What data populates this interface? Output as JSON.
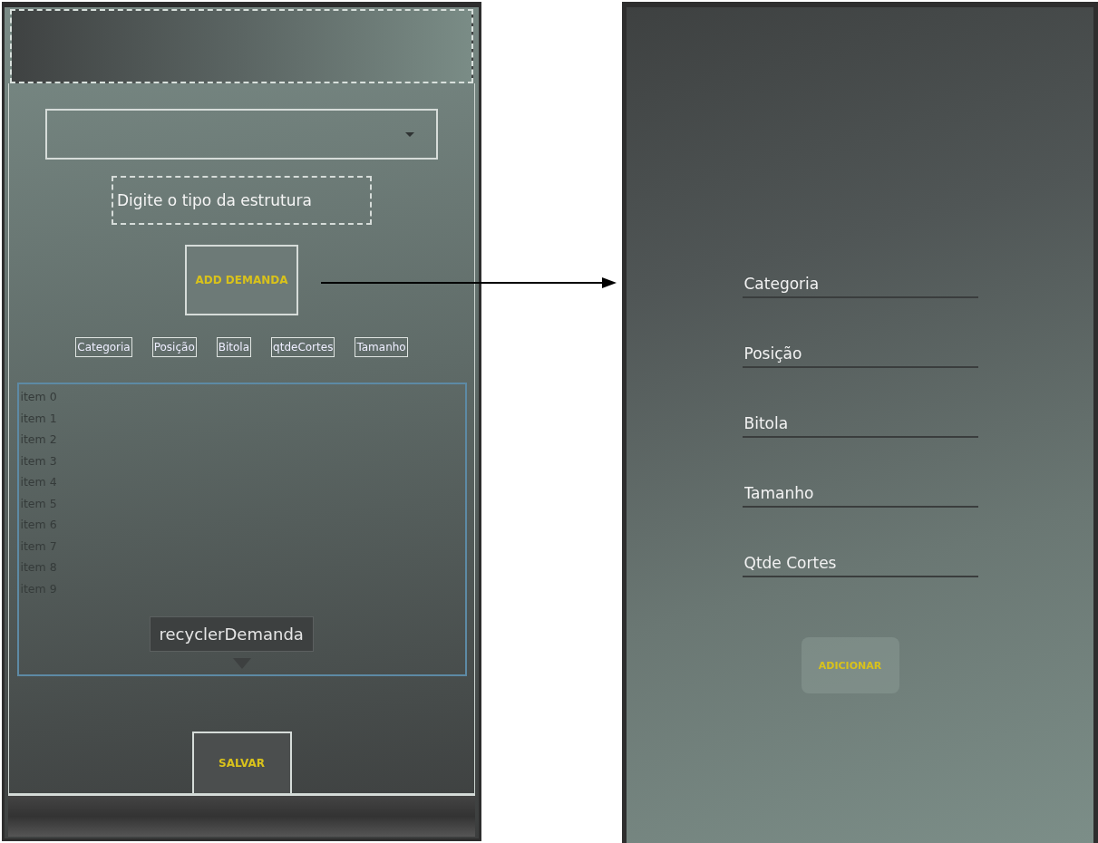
{
  "design_screen": {
    "structure_field": {
      "placeholder": "Digite o tipo da estrutura"
    },
    "add_button": "ADD DEMANDA",
    "headers": [
      "Categoria",
      "Posição",
      "Bitola",
      "qtdeCortes",
      "Tamanho"
    ],
    "list_items": [
      "item 0",
      "item 1",
      "item 2",
      "item 3",
      "item 4",
      "item 5",
      "item 6",
      "item 7",
      "item 8",
      "item 9"
    ],
    "tooltip": "recyclerDemanda",
    "save_button": "SALVAR"
  },
  "dialog_screen": {
    "fields": [
      {
        "placeholder": "Categoria"
      },
      {
        "placeholder": "Posição"
      },
      {
        "placeholder": "Bitola"
      },
      {
        "placeholder": "Tamanho"
      },
      {
        "placeholder": "Qtde Cortes"
      }
    ],
    "add_button": "ADICIONAR"
  }
}
